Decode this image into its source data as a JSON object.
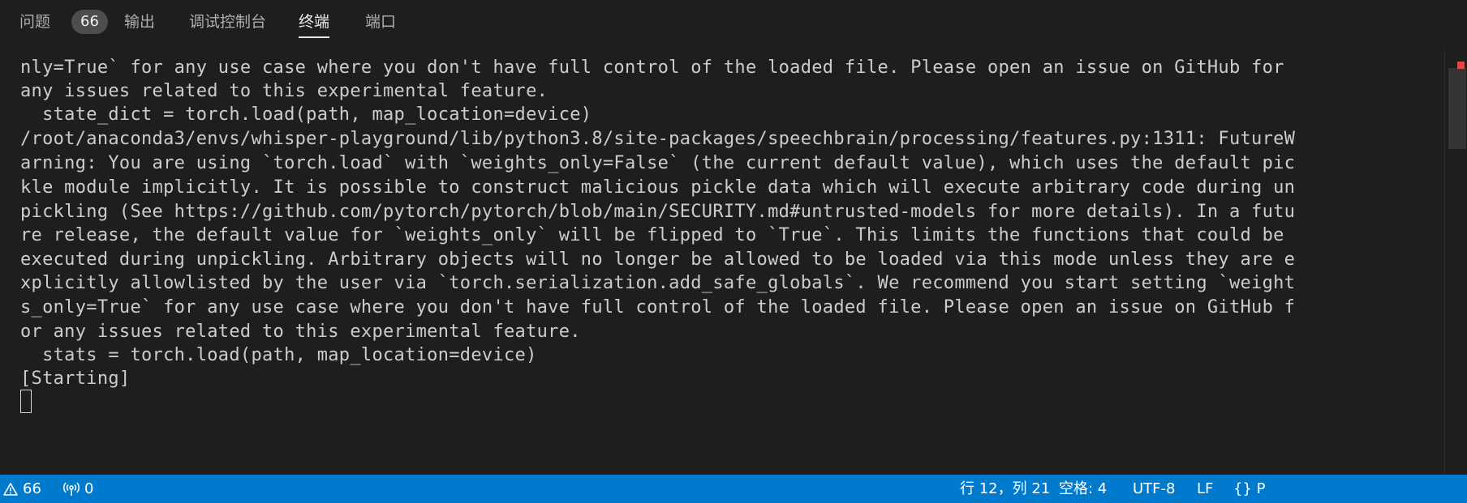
{
  "tabs": [
    {
      "label": "问题",
      "badge": "66",
      "active": false
    },
    {
      "label": "输出",
      "active": false
    },
    {
      "label": "调试控制台",
      "active": false
    },
    {
      "label": "终端",
      "active": true
    },
    {
      "label": "端口",
      "active": false
    }
  ],
  "terminal": {
    "lines": [
      "nly=True` for any use case where you don't have full control of the loaded file. Please open an issue on GitHub for",
      "any issues related to this experimental feature.",
      "  state_dict = torch.load(path, map_location=device)",
      "/root/anaconda3/envs/whisper-playground/lib/python3.8/site-packages/speechbrain/processing/features.py:1311: FutureW",
      "arning: You are using `torch.load` with `weights_only=False` (the current default value), which uses the default pic",
      "kle module implicitly. It is possible to construct malicious pickle data which will execute arbitrary code during un",
      "pickling (See https://github.com/pytorch/pytorch/blob/main/SECURITY.md#untrusted-models for more details). In a futu",
      "re release, the default value for `weights_only` will be flipped to `True`. This limits the functions that could be",
      "executed during unpickling. Arbitrary objects will no longer be allowed to be loaded via this mode unless they are e",
      "xplicitly allowlisted by the user via `torch.serialization.add_safe_globals`. We recommend you start setting `weight",
      "s_only=True` for any use case where you don't have full control of the loaded file. Please open an issue on GitHub f",
      "or any issues related to this experimental feature.",
      "  stats = torch.load(path, map_location=device)",
      "[Starting]"
    ]
  },
  "statusbar": {
    "problems_count": "66",
    "ports_count": "0",
    "cursor_position": "行 12，列 21",
    "indentation": "空格: 4",
    "encoding": "UTF-8",
    "eol": "LF",
    "language_icon": "{}",
    "language": "P"
  },
  "colors": {
    "background": "#1e1e1e",
    "statusbar": "#007acc",
    "terminal_text": "#cccccc",
    "badge": "#4d4d4d"
  }
}
